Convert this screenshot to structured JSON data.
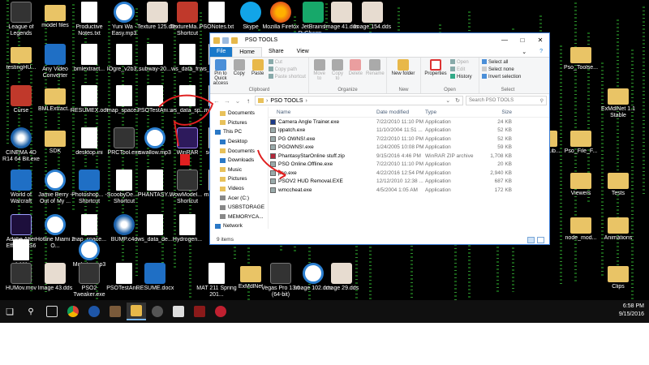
{
  "desktop": {
    "icons": [
      {
        "label": "League of Legends",
        "kind": "dark"
      },
      {
        "label": "model files",
        "kind": "folder"
      },
      {
        "label": "Productive Notes.txt",
        "kind": "doc"
      },
      {
        "label": "Yuni Wa - Easy.mp3",
        "kind": "circ"
      },
      {
        "label": "Texture 125.dds",
        "kind": "face"
      },
      {
        "label": "TextureMa... - Shortcut",
        "kind": "red"
      },
      {
        "label": "PSONotes.txt",
        "kind": "doc"
      },
      {
        "label": "Skype",
        "kind": "skyp"
      },
      {
        "label": "Mozilla Firefox",
        "kind": "fire"
      },
      {
        "label": "JetBrains PyCharm ...",
        "kind": "pc"
      },
      {
        "label": "Image 41.dds",
        "kind": "face"
      },
      {
        "label": "Image 154.dds",
        "kind": "face"
      },
      {
        "label": "testingHU...",
        "kind": "folder"
      },
      {
        "label": "Any Video Converter",
        "kind": "blue"
      },
      {
        "label": "bmlextract...",
        "kind": "doc"
      },
      {
        "label": "IOgre_v2b3...",
        "kind": "doc"
      },
      {
        "label": "subway-20...",
        "kind": "doc"
      },
      {
        "label": "ws_data_fr...",
        "kind": "doc"
      },
      {
        "label": "ws_data_m...",
        "kind": "doc"
      },
      {
        "label": "Curse",
        "kind": "red"
      },
      {
        "label": "BMLExtract...",
        "kind": "folder"
      },
      {
        "label": "RESUMEX.odt",
        "kind": "doc"
      },
      {
        "label": "map_space...",
        "kind": "doc"
      },
      {
        "label": "ws_data_sp...",
        "kind": "doc"
      },
      {
        "label": "PSOTestAni...",
        "kind": "doc"
      },
      {
        "label": "map_sp...",
        "kind": "doc"
      },
      {
        "label": "CINEMA 4D R14 64 Bit.exe",
        "kind": "c4d"
      },
      {
        "label": "SDK",
        "kind": "folder"
      },
      {
        "label": "desktop.ini",
        "kind": "doc"
      },
      {
        "label": "PRCTool.exe",
        "kind": "dark"
      },
      {
        "label": "swallow.mp3",
        "kind": "circ"
      },
      {
        "label": "WinRAR",
        "kind": "purple"
      },
      {
        "label": "screen...",
        "kind": "doc"
      },
      {
        "label": "World of Warcraft",
        "kind": "blue"
      },
      {
        "label": "Jamie Berry - Out of My ...",
        "kind": "circ"
      },
      {
        "label": "Photoshop... - Shortcut",
        "kind": "blue"
      },
      {
        "label": "ScoobyDe... - Shortcut",
        "kind": "doc"
      },
      {
        "label": "PHANTASY...",
        "kind": "doc"
      },
      {
        "label": "WowModel... - Shortcut",
        "kind": "dark"
      },
      {
        "label": "map_sp...",
        "kind": "doc"
      },
      {
        "label": "Adobe After Effects CS6",
        "kind": "ae"
      },
      {
        "label": "Hotline Miami 2 O...",
        "kind": "circ"
      },
      {
        "label": "map_space...",
        "kind": "doc"
      },
      {
        "label": "BUMP.c4d",
        "kind": "c4d"
      },
      {
        "label": "ws_data_de...",
        "kind": "doc"
      },
      {
        "label": "Hydrogen...",
        "kind": "doc"
      },
      {
        "label": ".dxl file",
        "kind": "doc"
      },
      {
        "label": "Mobster.mp3",
        "kind": "circ"
      },
      {
        "label": "HUMov.mov",
        "kind": "dark"
      },
      {
        "label": "Image 43.dds",
        "kind": "face"
      },
      {
        "label": "PSO2 Tweaker.exe",
        "kind": "dark"
      },
      {
        "label": "PSOTestAni...",
        "kind": "doc"
      },
      {
        "label": "RESUME.docx",
        "kind": "blue"
      },
      {
        "label": "MAT 211 Spring 201...",
        "kind": "doc"
      },
      {
        "label": "ExMdlNet",
        "kind": "folder"
      },
      {
        "label": "Vegas Pro 13.0 (64-bit)",
        "kind": "dark"
      },
      {
        "label": "Image 102.dds",
        "kind": "circ"
      },
      {
        "label": "Image 29.dds",
        "kind": "face"
      },
      {
        "label": "Pso_Toolse...",
        "kind": "folder"
      },
      {
        "label": "ExMdlNet 1.1 Stable",
        "kind": "folder"
      },
      {
        "label": "Ninja-Lib...",
        "kind": "folder"
      },
      {
        "label": "Pso_File_F...",
        "kind": "folder"
      },
      {
        "label": "Viewers",
        "kind": "folder"
      },
      {
        "label": "Tests",
        "kind": "folder"
      },
      {
        "label": "node_mod...",
        "kind": "folder"
      },
      {
        "label": "Animations",
        "kind": "folder"
      },
      {
        "label": "Clips",
        "kind": "folder"
      }
    ]
  },
  "explorer": {
    "title": "PSO TOOLS",
    "tabs": [
      "File",
      "Home",
      "Share",
      "View"
    ],
    "ribbon": {
      "clipboard": {
        "pin": "Pin to Quick access",
        "copy": "Copy",
        "paste": "Paste",
        "cut": "Cut",
        "copy_path": "Copy path",
        "paste_shortcut": "Paste shortcut",
        "group": "Clipboard"
      },
      "organize": {
        "move_to": "Move to",
        "copy_to": "Copy to",
        "delete": "Delete",
        "rename": "Rename",
        "group": "Organize"
      },
      "new": {
        "new_folder": "New folder",
        "group": "New"
      },
      "open": {
        "properties": "Properties",
        "open": "Open",
        "edit": "Edit",
        "history": "History",
        "group": "Open"
      },
      "select": {
        "select_all": "Select all",
        "select_none": "Select none",
        "invert": "Invert selection",
        "group": "Select"
      }
    },
    "address": {
      "path": "PSO TOOLS",
      "search_placeholder": "Search PSO TOOLS"
    },
    "nav": [
      {
        "label": "Documents",
        "kind": "folder"
      },
      {
        "label": "Pictures",
        "kind": "folder"
      },
      {
        "label": "This PC",
        "kind": "pc"
      },
      {
        "label": "Desktop",
        "kind": "pc"
      },
      {
        "label": "Documents",
        "kind": "folder"
      },
      {
        "label": "Downloads",
        "kind": "pc"
      },
      {
        "label": "Music",
        "kind": "folder"
      },
      {
        "label": "Pictures",
        "kind": "folder"
      },
      {
        "label": "Videos",
        "kind": "folder"
      },
      {
        "label": "Acer (C:)",
        "kind": "drive"
      },
      {
        "label": "USBSTORAGE",
        "kind": "drive"
      },
      {
        "label": "MEMORYCA...",
        "kind": "drive"
      },
      {
        "label": "Network",
        "kind": "pc"
      }
    ],
    "columns": {
      "name": "Name",
      "date": "Date modified",
      "type": "Type",
      "size": "Size"
    },
    "files": [
      {
        "name": "Camera Angle Trainer.exe",
        "date": "7/22/2010 11:10 PM",
        "type": "Application",
        "size": "24 KB",
        "icon": "exe"
      },
      {
        "name": "ippatch.exe",
        "date": "11/10/2004 11:51 ...",
        "type": "Application",
        "size": "52 KB",
        "icon": "app"
      },
      {
        "name": "PG OWNS!.exe",
        "date": "7/22/2010 11:10 PM",
        "type": "Application",
        "size": "52 KB",
        "icon": "app"
      },
      {
        "name": "PGOWNS!.exe",
        "date": "1/24/2005 10:08 PM",
        "type": "Application",
        "size": "59 KB",
        "icon": "app"
      },
      {
        "name": "PhantasyStarOnline stuff.zip",
        "date": "9/15/2016 4:46 PM",
        "type": "WinRAR ZIP archive",
        "size": "1,708 KB",
        "icon": "zip"
      },
      {
        "name": "PSO Online.Offline.exe",
        "date": "7/22/2010 11:10 PM",
        "type": "Application",
        "size": "20 KB",
        "icon": "app"
      },
      {
        "name": "pso.exe",
        "date": "4/22/2016 12:54 PM",
        "type": "Application",
        "size": "2,940 KB",
        "icon": "app"
      },
      {
        "name": "PSOV2 HUD Removal.EXE",
        "date": "12/12/2010 12:38 ...",
        "type": "Application",
        "size": "687 KB",
        "icon": "app"
      },
      {
        "name": "wmccheat.exe",
        "date": "4/5/2004 1:05 AM",
        "type": "Application",
        "size": "172 KB",
        "icon": "app"
      }
    ],
    "status": "9 items"
  },
  "taskbar": {
    "time": "6:58 PM",
    "date": "9/15/2016"
  },
  "colors": {
    "accent": "#1979ca",
    "annotation": "#e02020"
  }
}
